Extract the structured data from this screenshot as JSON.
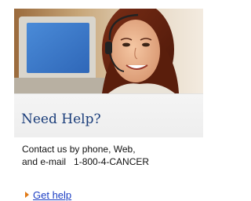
{
  "panel": {
    "title": "Need Help?",
    "body_line1": "Contact us by phone, Web,",
    "body_line2": "and e-mail   1-800-4-CANCER",
    "link_label": "Get help",
    "colors": {
      "title": "#1a3d7a",
      "link": "#1d3fc4",
      "arrow": "#e07a17"
    },
    "icons": {
      "link_arrow": "right-triangle-arrow-icon"
    }
  }
}
